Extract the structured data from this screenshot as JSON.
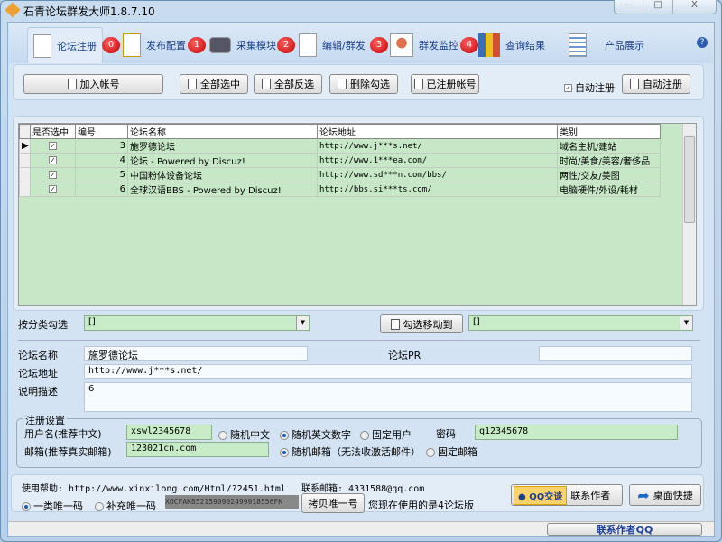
{
  "window": {
    "title": "石青论坛群发大师1.8.7.10",
    "min": "—",
    "max": "□",
    "close": "X"
  },
  "tabs": [
    {
      "label": "论坛注册",
      "badge": "0"
    },
    {
      "label": "发布配置",
      "badge": "1"
    },
    {
      "label": "采集模块",
      "badge": "2"
    },
    {
      "label": "编辑/群发",
      "badge": "3"
    },
    {
      "label": "群发监控",
      "badge": "4"
    },
    {
      "label": "查询结果"
    },
    {
      "label": "产品展示"
    }
  ],
  "toolbar": {
    "add_account": "加入帐号",
    "select_all": "全部选中",
    "invert": "全部反选",
    "delete_checked": "删除勾选",
    "registered": "已注册帐号",
    "auto_register_check": "自动注册",
    "auto_register_btn": "自动注册"
  },
  "grid": {
    "headers": [
      "是否选中",
      "编号",
      "论坛名称",
      "论坛地址",
      "类别"
    ],
    "rows": [
      {
        "id": "3",
        "name": "施罗德论坛",
        "url": "http://www.j***s.net/",
        "cat": "域名主机/建站"
      },
      {
        "id": "4",
        "name": "论坛 -  Powered by Discuz!",
        "url": "http://www.1***ea.com/",
        "cat": "时尚/美食/美容/奢侈品"
      },
      {
        "id": "5",
        "name": "中国粉体设备论坛",
        "url": "http://www.sd***n.com/bbs/",
        "cat": "两性/交友/美图"
      },
      {
        "id": "6",
        "name": " 全球汉语BBS  - Powered by Discuz!",
        "url": "http://bbs.si***ts.com/",
        "cat": "电脑硬件/外设/耗材"
      }
    ]
  },
  "category": {
    "label": "按分类勾选",
    "value": "[]",
    "move_btn": "勾选移动到",
    "move_value": "[]"
  },
  "form": {
    "name_label": "论坛名称",
    "name": "施罗德论坛",
    "pr_label": "论坛PR",
    "pr": "",
    "url_label": "论坛地址",
    "url": "http://www.j***s.net/",
    "desc_label": "说明描述",
    "desc": "6"
  },
  "reg": {
    "legend": "注册设置",
    "user_label": "用户名(推荐中文)",
    "user": "xswl2345678",
    "rand_cn": "随机中文",
    "rand_en": "随机英文数字",
    "fixed_user": "固定用户",
    "pwd_label": "密码",
    "pwd": "q12345678",
    "mail_label": "邮箱(推荐真实邮箱)",
    "mail": "123021cn.com",
    "rand_mail": "随机邮箱（无法收激活邮件）",
    "fixed_mail": "固定邮箱"
  },
  "bottom": {
    "help": "使用帮助: http://www.xinxilong.com/Html/?2451.html",
    "contact_mail": "联系邮箱: 4331588@qq.com",
    "code1": "一类唯一码",
    "code2": "补充唯一码",
    "code": "XOCFAK8521590902499918556FK",
    "copy_btn": "拷贝唯一号",
    "version": "您现在使用的是4论坛版",
    "qq": "QQ交谈",
    "contact_author": "联系作者",
    "shortcut": "桌面快捷"
  },
  "status": {
    "contact_qq": "联系作者QQ"
  }
}
